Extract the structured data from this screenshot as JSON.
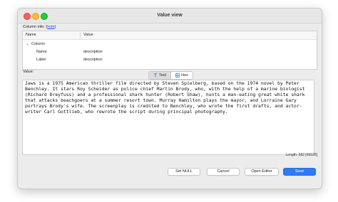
{
  "window": {
    "title": "Value view"
  },
  "column_info": {
    "label": "Column info: (",
    "toggle": "hide",
    "suffix": ")"
  },
  "column_table": {
    "headers": [
      "Name",
      "Value"
    ],
    "group": "Column",
    "rows": [
      {
        "name": "Name",
        "value": "description"
      },
      {
        "name": "Label",
        "value": "description"
      }
    ]
  },
  "value_section": {
    "label": "Value:",
    "tabs": [
      {
        "label": "Text",
        "icon": "text-format-icon",
        "active": true
      },
      {
        "label": "Hex",
        "icon": "hex-grid-icon",
        "active": false
      }
    ],
    "text": "Jaws is a 1975 American thriller film directed by Steven Spielberg, based on the 1974 novel by Peter Benchley. It stars Roy Scheider as police chief Martin Brody, who, with the help of a marine biologist (Richard Dreyfuss) and a professional shark hunter (Robert Shaw), hunts a man-eating great white shark that attacks beachgoers at a summer resort town. Murray Hamilton plays the mayor, and Lorraine Gary portrays Brody's wife. The screenplay is credited to Benchley, who wrote the first drafts, and actor-writer Carl Gottlieb, who rewrote the script during principal photography.",
    "length": "Length: 582 [65535]"
  },
  "buttons": {
    "set_null": "Set NULL",
    "cancel": "Cancel",
    "open_editor": "Open Editor",
    "save": "Save"
  },
  "colors": {
    "accent": "#2f7bf6",
    "link": "#1e5bd6",
    "close": "#fe5f57",
    "minimize": "#febc2e",
    "maximize": "#28c840"
  }
}
